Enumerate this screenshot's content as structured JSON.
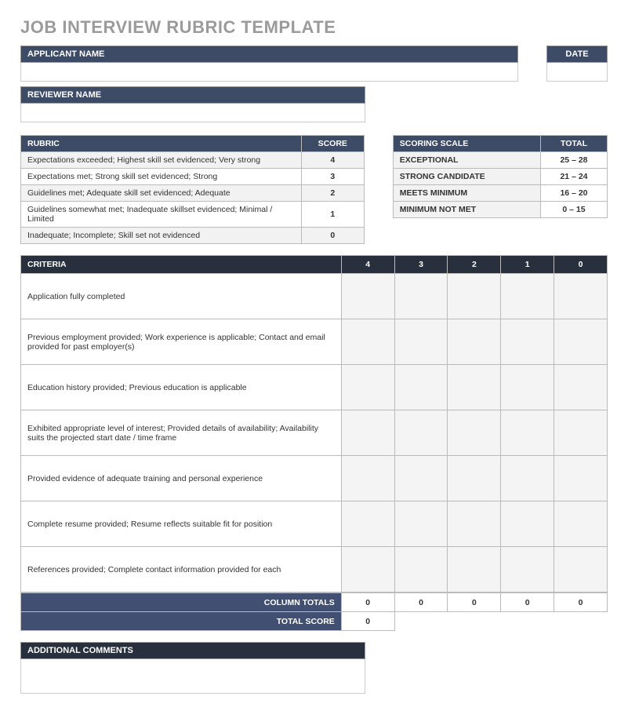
{
  "title": "JOB INTERVIEW RUBRIC TEMPLATE",
  "headers": {
    "applicant_name": "APPLICANT NAME",
    "date": "DATE",
    "reviewer_name": "REVIEWER NAME",
    "rubric": "RUBRIC",
    "score": "SCORE",
    "scoring_scale": "SCORING SCALE",
    "total": "TOTAL",
    "criteria": "CRITERIA",
    "column_totals": "COLUMN TOTALS",
    "total_score": "TOTAL SCORE",
    "additional_comments": "ADDITIONAL COMMENTS"
  },
  "rubric": [
    {
      "desc": "Expectations exceeded; Highest skill set evidenced; Very strong",
      "score": "4"
    },
    {
      "desc": "Expectations met; Strong skill set evidenced; Strong",
      "score": "3"
    },
    {
      "desc": "Guidelines met; Adequate skill set evidenced; Adequate",
      "score": "2"
    },
    {
      "desc": "Guidelines somewhat met; Inadequate skillset evidenced; Minimal / Limited",
      "score": "1"
    },
    {
      "desc": "Inadequate; Incomplete; Skill set not evidenced",
      "score": "0"
    }
  ],
  "scale": [
    {
      "label": "EXCEPTIONAL",
      "range": "25 – 28"
    },
    {
      "label": "STRONG CANDIDATE",
      "range": "21 – 24"
    },
    {
      "label": "MEETS MINIMUM",
      "range": "16 – 20"
    },
    {
      "label": "MINIMUM NOT MET",
      "range": "0 – 15"
    }
  ],
  "criteria_cols": [
    "4",
    "3",
    "2",
    "1",
    "0"
  ],
  "criteria": [
    "Application fully completed",
    "Previous employment provided; Work experience is applicable; Contact and email provided for past employer(s)",
    "Education history provided; Previous education is applicable",
    "Exhibited appropriate level of interest; Provided details of availability; Availability suits the projected start date / time frame",
    "Provided evidence of adequate training and personal experience",
    "Complete resume provided; Resume reflects suitable fit for position",
    "References provided; Complete contact information provided for each"
  ],
  "column_totals": [
    "0",
    "0",
    "0",
    "0",
    "0"
  ],
  "total_score": "0"
}
